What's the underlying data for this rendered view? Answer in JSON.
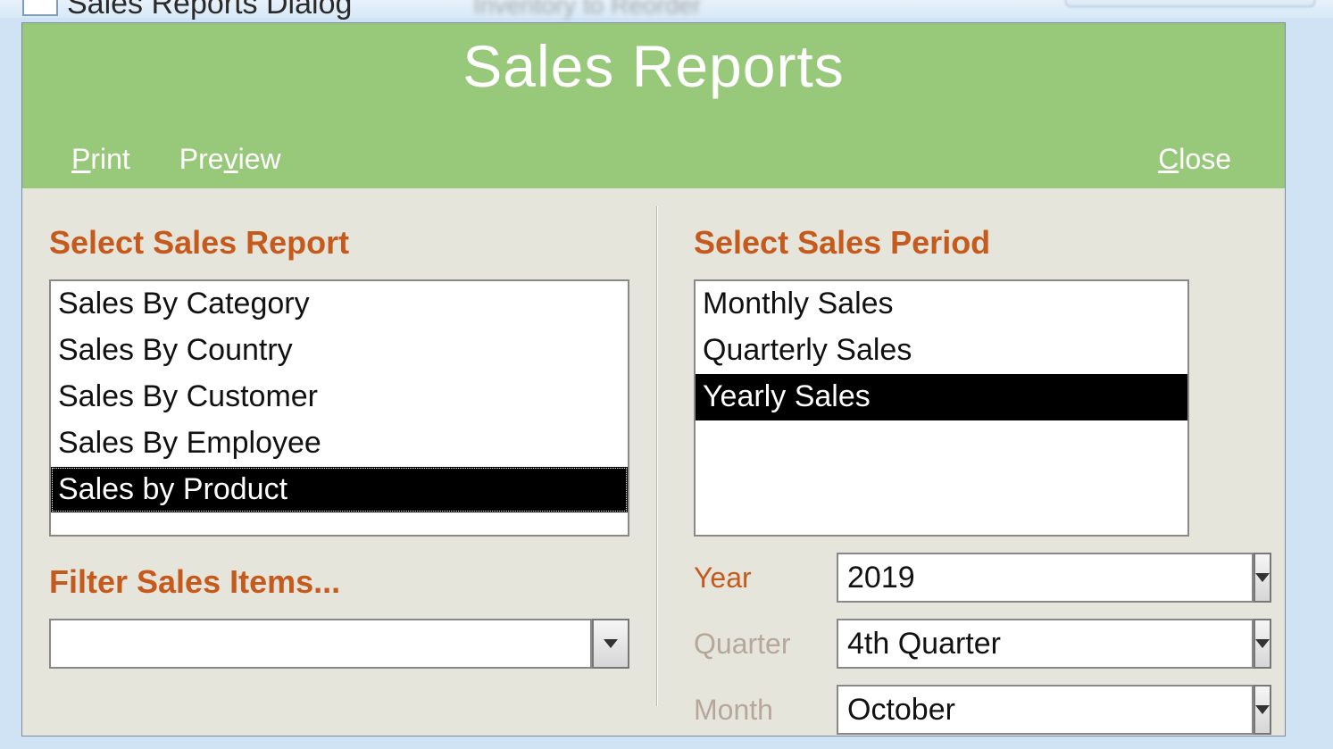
{
  "window": {
    "title": "Sales Reports Dialog",
    "ghost_tab": "Inventory to Reorder"
  },
  "header": {
    "title": "Sales Reports",
    "print": "Print",
    "preview": "Preview",
    "close": "Close"
  },
  "left": {
    "section_label": "Select Sales Report",
    "reports": [
      "Sales By Category",
      "Sales By Country",
      "Sales By Customer",
      "Sales By Employee",
      "Sales by Product"
    ],
    "selected_report_index": 4,
    "filter_label": "Filter Sales Items...",
    "filter_value": ""
  },
  "right": {
    "section_label": "Select Sales Period",
    "periods": [
      "Monthly Sales",
      "Quarterly Sales",
      "Yearly Sales"
    ],
    "selected_period_index": 2,
    "year_label": "Year",
    "year_value": "2019",
    "quarter_label": "Quarter",
    "quarter_value": "4th Quarter",
    "month_label": "Month",
    "month_value": "October"
  }
}
